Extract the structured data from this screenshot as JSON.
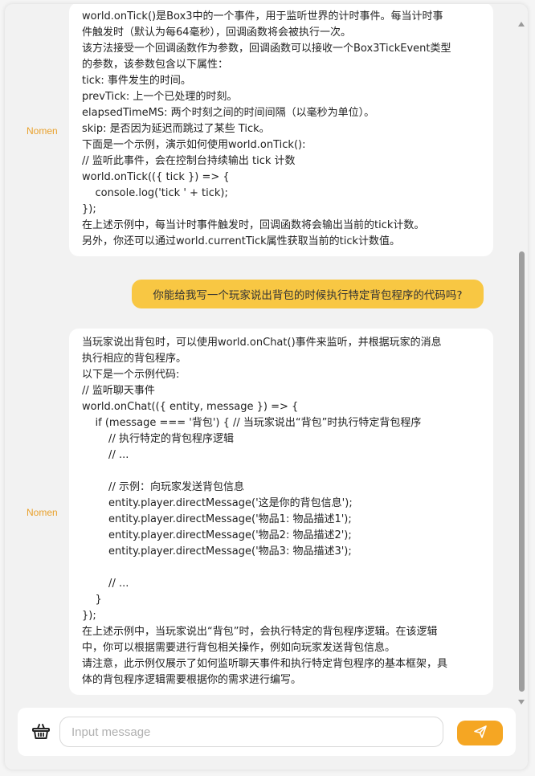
{
  "colors": {
    "accent": "#f5a623",
    "user_bubble": "#f8c743",
    "sender_label": "#e9a12c"
  },
  "messages": [
    {
      "sender": "Nomen",
      "lines": [
        "world.onTick()是Box3中的一个事件，用于监听世界的计时事件。每当计时事",
        "件触发时（默认为每64毫秒），回调函数将会被执行一次。",
        "该方法接受一个回调函数作为参数，回调函数可以接收一个Box3TickEvent类型",
        "的参数，该参数包含以下属性：",
        "tick: 事件发生的时间。",
        "prevTick: 上一个已处理的时刻。",
        "elapsedTimeMS: 两个时刻之间的时间间隔（以毫秒为单位）。",
        "skip: 是否因为延迟而跳过了某些 Tick。",
        "下面是一个示例，演示如何使用world.onTick():",
        "// 监听此事件，会在控制台持续输出 tick 计数",
        "world.onTick(({ tick }) => {",
        "    console.log('tick ' + tick);",
        "});",
        "在上述示例中，每当计时事件触发时，回调函数将会输出当前的tick计数。",
        "另外，你还可以通过world.currentTick属性获取当前的tick计数值。"
      ]
    },
    {
      "sender": "user",
      "text": "你能给我写一个玩家说出背包的时候执行特定背包程序的代码吗?"
    },
    {
      "sender": "Nomen",
      "lines": [
        "当玩家说出背包时，可以使用world.onChat()事件来监听，并根据玩家的消息",
        "执行相应的背包程序。",
        "以下是一个示例代码:",
        "// 监听聊天事件",
        "world.onChat(({ entity, message }) => {",
        "    if (message === '背包') { // 当玩家说出“背包”时执行特定背包程序",
        "        // 执行特定的背包程序逻辑",
        "        // ...",
        "",
        "        // 示例：向玩家发送背包信息",
        "        entity.player.directMessage('这是你的背包信息');",
        "        entity.player.directMessage('物品1: 物品描述1');",
        "        entity.player.directMessage('物品2: 物品描述2');",
        "        entity.player.directMessage('物品3: 物品描述3');",
        "",
        "        // ...",
        "    }",
        "});",
        "在上述示例中，当玩家说出“背包”时，会执行特定的背包程序逻辑。在该逻辑",
        "中，你可以根据需要进行背包相关操作，例如向玩家发送背包信息。",
        "请注意，此示例仅展示了如何监听聊天事件和执行特定背包程序的基本框架，具",
        "体的背包程序逻辑需要根据你的需求进行编写。"
      ]
    }
  ],
  "input": {
    "placeholder": "Input message",
    "value": ""
  },
  "icons": {
    "basket": "basket-icon",
    "send": "send-icon",
    "scroll_up": "chevron-up-icon",
    "scroll_down": "chevron-down-icon"
  }
}
